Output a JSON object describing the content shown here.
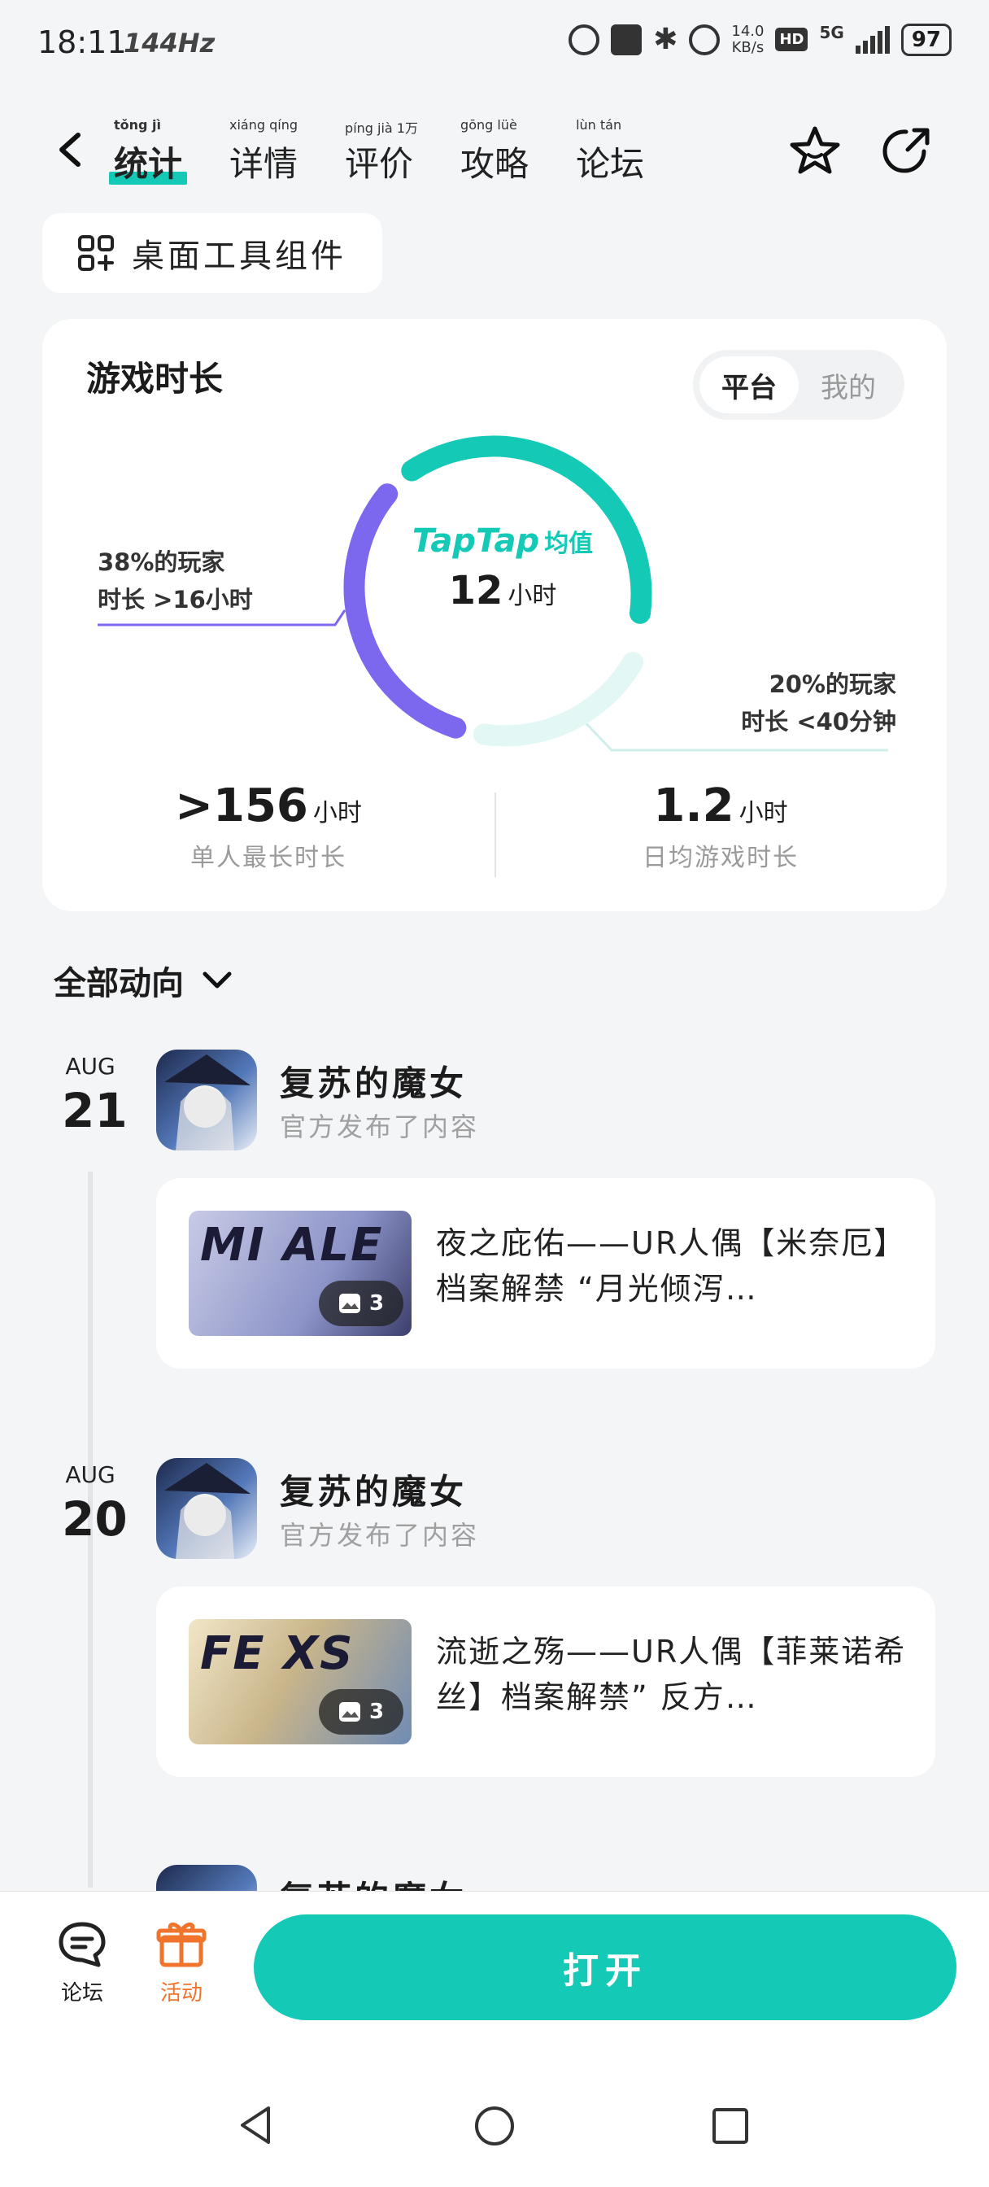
{
  "status_bar": {
    "time": "18:11",
    "refresh": "144Hz",
    "speed_value": "14.0",
    "speed_unit": "KB/s",
    "hd": "HD",
    "network": "5G",
    "battery": "97"
  },
  "nav": {
    "tabs": [
      {
        "label": "统计",
        "pinyin": "tǒng jì"
      },
      {
        "label": "详情",
        "pinyin": "xiáng qíng"
      },
      {
        "label": "评价",
        "pinyin": "píng jià 1万"
      },
      {
        "label": "攻略",
        "pinyin": "gōng lüè"
      },
      {
        "label": "论坛",
        "pinyin": "lùn tán"
      }
    ]
  },
  "widget_chip": {
    "label": "桌面工具组件"
  },
  "stats": {
    "title": "游戏时长",
    "segments": [
      "平台",
      "我的"
    ],
    "brand": "TapTap",
    "brand_suffix": "均值",
    "average_value": "12",
    "average_unit": "小时",
    "left_note_line1": "38%的玩家",
    "left_note_line2": "时长 >16小时",
    "right_note_line1": "20%的玩家",
    "right_note_line2": "时长 <40分钟",
    "max_value": ">156",
    "max_unit": "小时",
    "max_caption": "单人最长时长",
    "daily_value": "1.2",
    "daily_unit": "小时",
    "daily_caption": "日均游戏时长",
    "colors": {
      "teal": "#15c9b7",
      "purple": "#7b68ee",
      "light_teal": "#e3f7f5"
    }
  },
  "feed": {
    "filter_label": "全部动向",
    "posts": [
      {
        "month": "AUG",
        "day": "21",
        "app_name": "复苏的魔女",
        "subtitle": "官方发布了内容",
        "thumb_title": "MI ALE",
        "image_count": "3",
        "text": "夜之庇佑——UR人偶【米奈厄】档案解禁 “月光倾泻…"
      },
      {
        "month": "AUG",
        "day": "20",
        "app_name": "复苏的魔女",
        "subtitle": "官方发布了内容",
        "thumb_title": "FE XS",
        "image_count": "3",
        "text": "流逝之殇——UR人偶【菲莱诺希丝】档案解禁” 反方…"
      }
    ],
    "peek_app_name": "复苏的魔女"
  },
  "bottom_bar": {
    "forum_label": "论坛",
    "activity_label": "活动",
    "open_label": "打开",
    "accent_orange": "#f0742c"
  }
}
